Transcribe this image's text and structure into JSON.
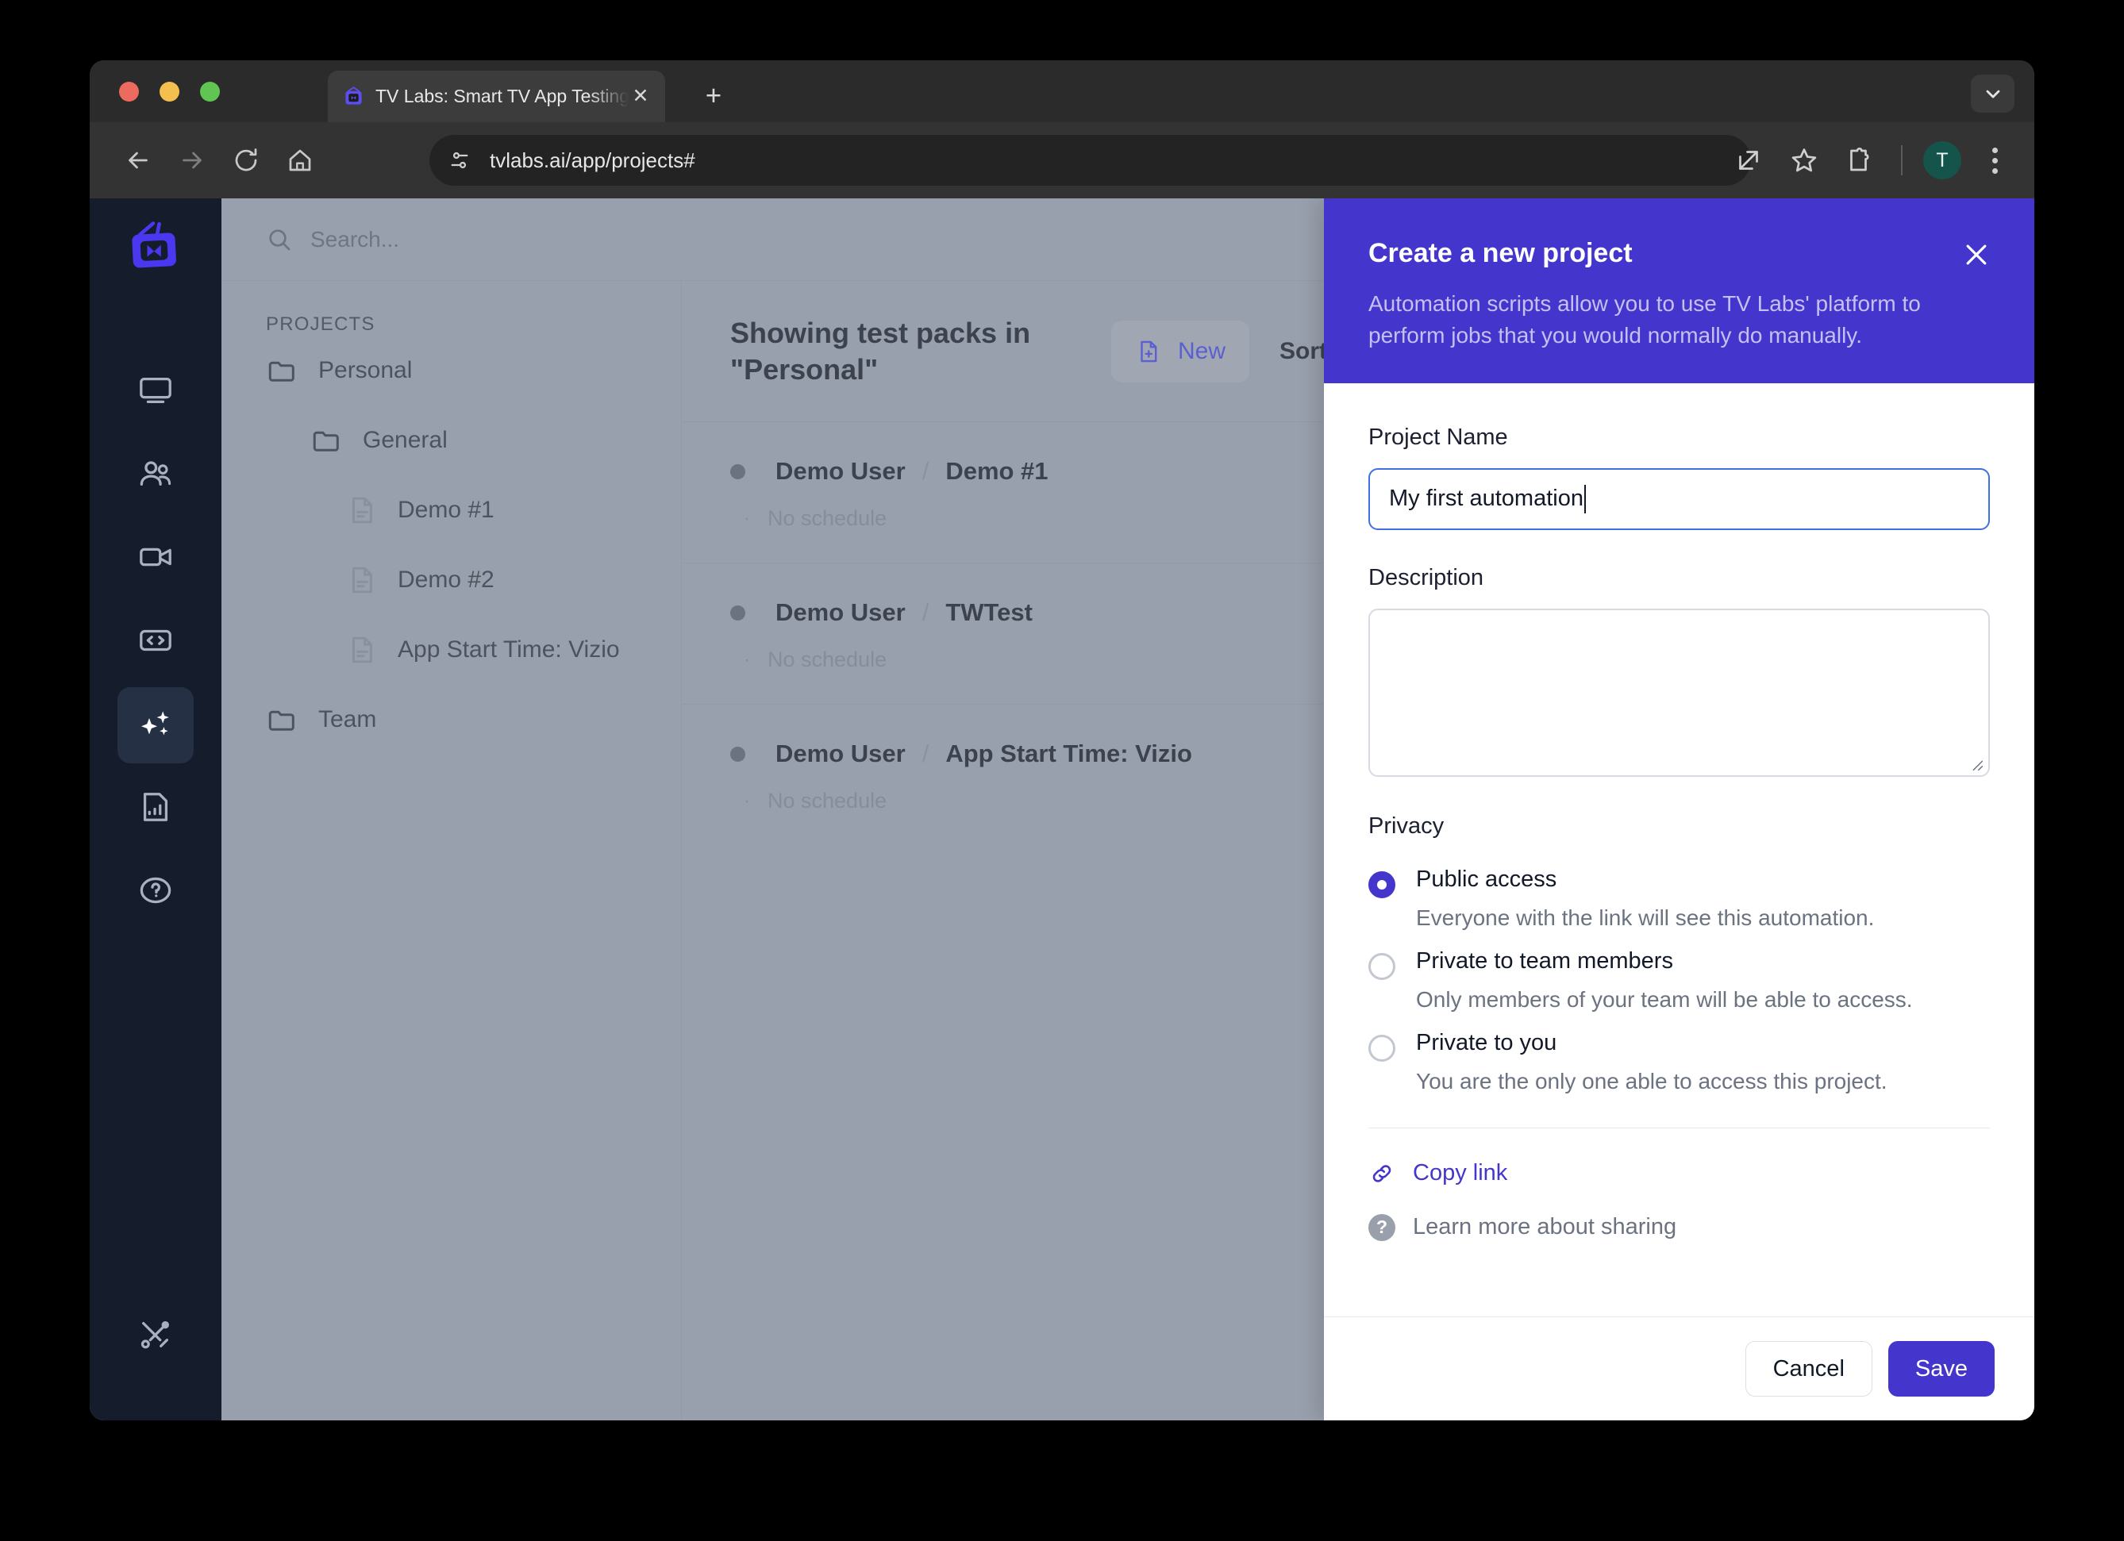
{
  "browser": {
    "tab": {
      "title": "TV Labs: Smart TV App Testing",
      "favicon_icon": "tv-favicon",
      "close_icon": "close-icon"
    },
    "new_tab_icon": "plus-icon",
    "tab_list_icon": "chevron-down-icon",
    "nav": {
      "back_icon": "arrow-left-icon",
      "forward_icon": "arrow-right-icon",
      "reload_icon": "reload-icon",
      "home_icon": "home-icon"
    },
    "omnibox": {
      "site_info_icon": "tune-icon",
      "url": "tvlabs.ai/app/projects#"
    },
    "actions": {
      "share_icon": "open-in-new-icon",
      "bookmark_icon": "star-icon",
      "extensions_icon": "puzzle-icon",
      "profile_initial": "T",
      "menu_icon": "more-vertical-icon"
    }
  },
  "app": {
    "rail": {
      "logo_icon": "tvlabs-logo-icon",
      "items": [
        {
          "icon": "monitor-icon",
          "name": "devices",
          "active": false
        },
        {
          "icon": "users-icon",
          "name": "team",
          "active": false
        },
        {
          "icon": "video-icon",
          "name": "sessions",
          "active": false
        },
        {
          "icon": "code-icon",
          "name": "code",
          "active": false
        },
        {
          "icon": "sparkles-icon",
          "name": "automations",
          "active": true
        },
        {
          "icon": "file-chart-icon",
          "name": "reports",
          "active": false
        },
        {
          "icon": "help-circle-icon",
          "name": "help",
          "active": false
        }
      ],
      "bottom_item": {
        "icon": "tools-icon",
        "name": "settings"
      }
    },
    "search": {
      "icon": "search-icon",
      "placeholder": "Search...",
      "value": ""
    },
    "projects": {
      "heading": "PROJECTS",
      "tree": [
        {
          "label": "Personal",
          "icon": "folder-icon",
          "depth": 0,
          "type": "folder"
        },
        {
          "label": "General",
          "icon": "folder-icon",
          "depth": 1,
          "type": "folder"
        },
        {
          "label": "Demo #1",
          "icon": "file-icon",
          "depth": 2,
          "type": "file"
        },
        {
          "label": "Demo #2",
          "icon": "file-icon",
          "depth": 2,
          "type": "file"
        },
        {
          "label": "App Start Time: Vizio",
          "icon": "file-icon",
          "depth": 2,
          "type": "file"
        },
        {
          "label": "Team",
          "icon": "folder-icon",
          "depth": 0,
          "type": "folder"
        }
      ]
    },
    "list": {
      "title": "Showing test packs in \"Personal\"",
      "new_button": {
        "label": "New",
        "icon": "file-plus-icon"
      },
      "sort_by_label": "Sort by",
      "separator": "/",
      "packs": [
        {
          "owner": "Demo User",
          "name": "Demo #1",
          "schedule": "No schedule"
        },
        {
          "owner": "Demo User",
          "name": "TWTest",
          "schedule": "No schedule"
        },
        {
          "owner": "Demo User",
          "name": "App Start Time: Vizio",
          "schedule": "No schedule"
        }
      ]
    }
  },
  "modal": {
    "title": "Create a new project",
    "subtitle": "Automation scripts allow you to use TV Labs' platform to perform jobs that you would normally do manually.",
    "close_icon": "close-icon",
    "project_name": {
      "label": "Project Name",
      "value": "My first automation",
      "placeholder": ""
    },
    "description": {
      "label": "Description",
      "value": "",
      "placeholder": ""
    },
    "privacy": {
      "label": "Privacy",
      "options": [
        {
          "title": "Public access",
          "desc": "Everyone with the link will see this automation.",
          "selected": true
        },
        {
          "title": "Private to team members",
          "desc": "Only members of your team will be able to access.",
          "selected": false
        },
        {
          "title": "Private to you",
          "desc": "You are the only one able to access this project.",
          "selected": false
        }
      ]
    },
    "copy_link": {
      "label": "Copy link",
      "icon": "link-icon"
    },
    "learn_more": {
      "label": "Learn more about sharing",
      "icon": "question-circle-icon"
    },
    "footer": {
      "cancel_label": "Cancel",
      "save_label": "Save"
    }
  },
  "colors": {
    "brand_purple": "#4436cd",
    "rail_dark": "#151c2c",
    "app_backdrop": "#99a0ad",
    "focus_blue": "#3f6fe0"
  }
}
